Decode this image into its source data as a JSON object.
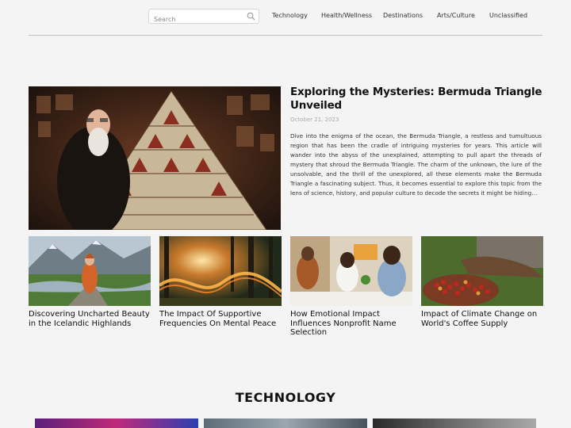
{
  "search": {
    "placeholder": "Search"
  },
  "nav": {
    "items": [
      "Technology",
      "Health/Wellness",
      "Destinations",
      "Arts/Culture",
      "Unclassified"
    ]
  },
  "hero": {
    "title": "Exploring the Mysteries: Bermuda Triangle Unveiled",
    "date": "October 21, 2023",
    "excerpt": "Dive into the enigma of the ocean, the Bermuda Triangle, a restless and tumultuous region that has been the cradle of intriguing mysteries for years. This article will wander into the abyss of the unexplained, attempting to pull apart the threads of mystery that shroud the Bermuda Triangle. The charm of the unknown, the lure of the unsolvable, and the thrill of the unexplored, all these elements make the Bermuda Triangle a fascinating subject. Thus, it becomes essential to explore this topic from the lens of science, history, and popular culture to decode the secrets it might be hiding…"
  },
  "cards": [
    {
      "title": "Discovering Uncharted Beauty in the Icelandic Highlands"
    },
    {
      "title": "The Impact Of Supportive Frequencies On Mental Peace"
    },
    {
      "title": "How Emotional Impact Influences Nonprofit Name Selection"
    },
    {
      "title": "Impact of Climate Change on World's Coffee Supply"
    }
  ],
  "section": {
    "heading": "TECHNOLOGY"
  },
  "icons": {
    "search": "search-icon"
  }
}
